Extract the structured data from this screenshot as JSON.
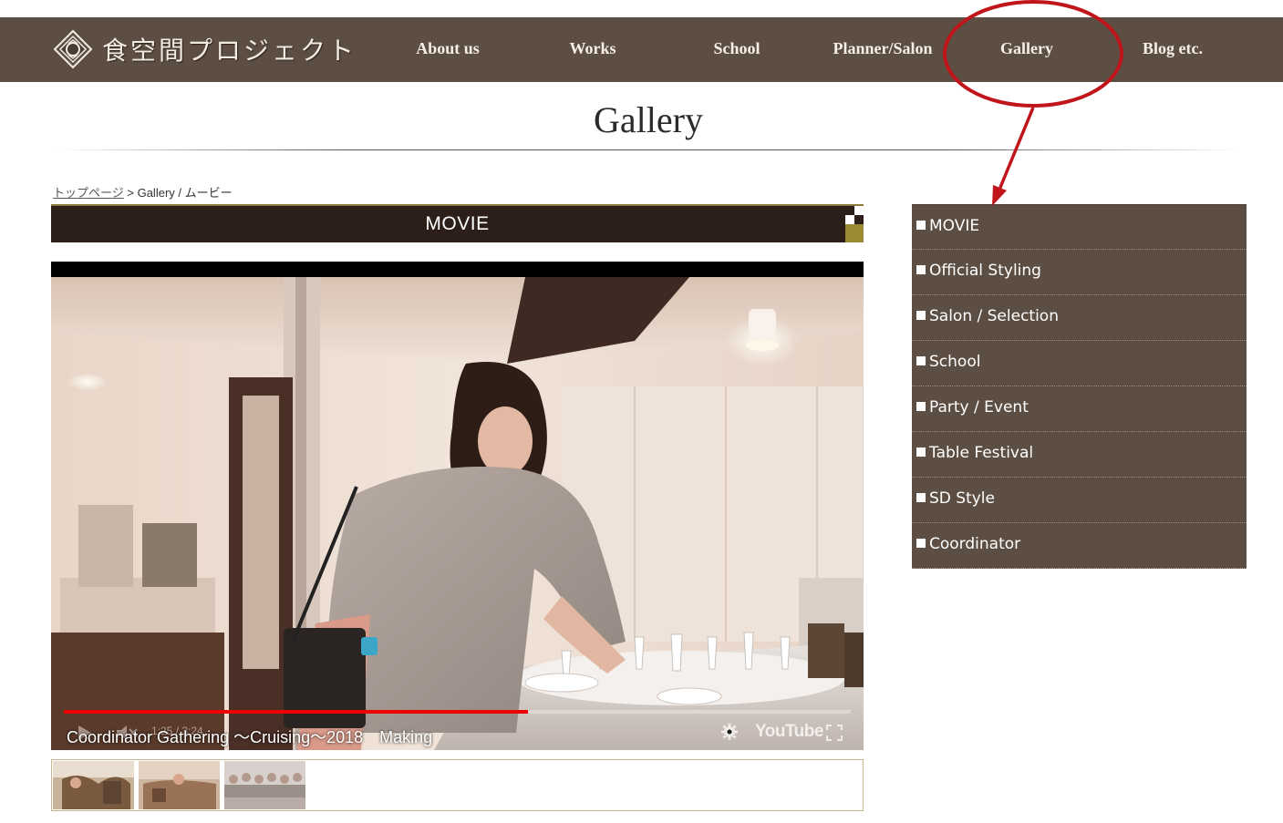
{
  "header": {
    "logo_text": "食空間プロジェクト",
    "nav": [
      "About us",
      "Works",
      "School",
      "Planner/Salon",
      "Gallery",
      "Blog etc."
    ]
  },
  "page": {
    "title": "Gallery"
  },
  "breadcrumb": {
    "home": "トップページ",
    "separator": ">",
    "current": "Gallery / ムービー"
  },
  "section": {
    "heading": "MOVIE"
  },
  "video": {
    "title": "Coordinator Gathering ～Cruising～2018　Making",
    "time": "1:25 / 3:24",
    "brand": "YouTube",
    "progress": 0.59
  },
  "thumbnails": {
    "count": 3
  },
  "sidebar": {
    "items": [
      "MOVIE",
      "Official Styling",
      "Salon / Selection",
      "School",
      "Party / Event",
      "Table Festival",
      "SD Style",
      "Coordinator"
    ]
  },
  "colors": {
    "header_bg": "#5d4e43",
    "movie_bar": "#2c1f1a",
    "accent_gold": "#9b8a34",
    "annotation_red": "#c0151b",
    "progress_red": "#e00000"
  }
}
